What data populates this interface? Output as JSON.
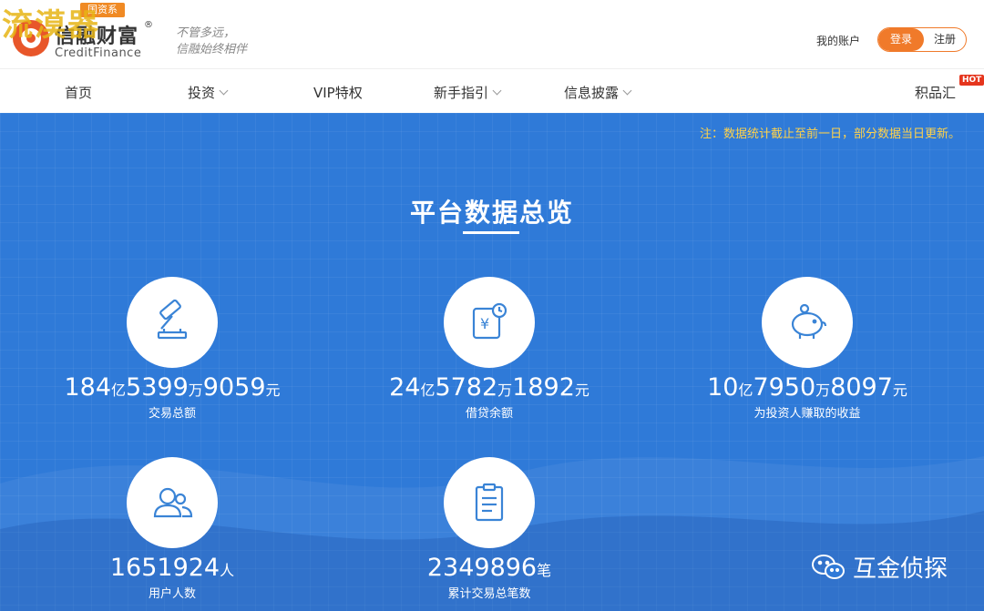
{
  "header": {
    "watermark": "流漠器",
    "logo_badge": "国资系",
    "logo_cn": "信融财富",
    "logo_reg": "®",
    "logo_en": "CreditFinance",
    "slogan_1": "不管多远，",
    "slogan_2": "信融始终相伴",
    "account": "我的账户",
    "login": "登录",
    "register": "注册"
  },
  "nav": {
    "items": [
      {
        "label": "首页"
      },
      {
        "label": "投资"
      },
      {
        "label": "VIP特权"
      },
      {
        "label": "新手指引"
      },
      {
        "label": "信息披露"
      },
      {
        "label": "积品汇"
      }
    ],
    "hot": "HOT"
  },
  "main": {
    "note": "注：数据统计截止至前一日，部分数据当日更新。",
    "title": "平台数据总览",
    "stats": [
      {
        "icon": "gavel-icon",
        "a": "184",
        "au": "亿",
        "b": "5399",
        "bu": "万",
        "c": "9059",
        "cu": "元",
        "label": "交易总额"
      },
      {
        "icon": "loan-icon",
        "a": "24",
        "au": "亿",
        "b": "5782",
        "bu": "万",
        "c": "1892",
        "cu": "元",
        "label": "借贷余额"
      },
      {
        "icon": "piggy-bank-icon",
        "a": "10",
        "au": "亿",
        "b": "7950",
        "bu": "万",
        "c": "8097",
        "cu": "元",
        "label": "为投资人赚取的收益"
      },
      {
        "icon": "users-icon",
        "a": "1651924",
        "au": "人",
        "label": "用户人数"
      },
      {
        "icon": "clipboard-icon",
        "a": "2349896",
        "au": "笔",
        "label": "累计交易总笔数"
      }
    ],
    "wechat_label": "互金侦探"
  },
  "colors": {
    "accent": "#f07a2a",
    "main_bg": "#2f7ad8",
    "note": "#ffd24a",
    "hot": "#e5351d"
  }
}
